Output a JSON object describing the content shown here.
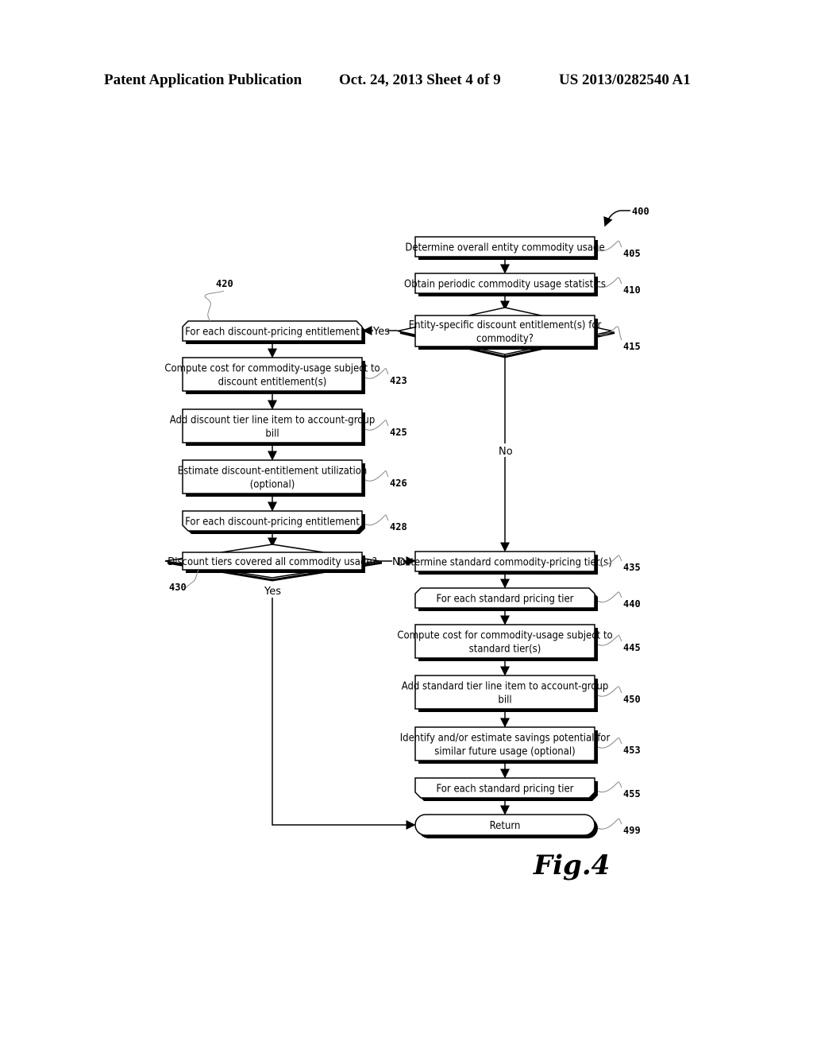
{
  "header": {
    "publication": "Patent Application Publication",
    "date_sheet": "Oct. 24, 2013   Sheet 4 of 9",
    "number": "US 2013/0282540 A1"
  },
  "diagram": {
    "ref": "400",
    "figure_label": "Fig.4",
    "nodes": {
      "n405": {
        "ref": "405",
        "lines": [
          "Determine overall entity commodity usage"
        ]
      },
      "n410": {
        "ref": "410",
        "lines": [
          "Obtain periodic commodity usage statistics"
        ]
      },
      "n415": {
        "ref": "415",
        "lines": [
          "Entity-specific discount entitlement(s) for",
          "commodity?"
        ]
      },
      "n420": {
        "ref": "420",
        "lines": [
          "For each discount-pricing entitlement"
        ]
      },
      "n423": {
        "ref": "423",
        "lines": [
          "Compute cost for commodity-usage subject to",
          "discount entitlement(s)"
        ]
      },
      "n425": {
        "ref": "425",
        "lines": [
          "Add discount tier line item to account-group",
          "bill"
        ]
      },
      "n426": {
        "ref": "426",
        "lines": [
          "Estimate discount-entitlement utilization",
          "(optional)"
        ]
      },
      "n428": {
        "ref": "428",
        "lines": [
          "For each discount-pricing entitlement"
        ]
      },
      "n430": {
        "ref": "430",
        "lines": [
          "Discount tiers covered all commodity usage?"
        ]
      },
      "n435": {
        "ref": "435",
        "lines": [
          "Determine standard commodity-pricing tier(s)"
        ]
      },
      "n440": {
        "ref": "440",
        "lines": [
          "For each standard pricing tier"
        ]
      },
      "n445": {
        "ref": "445",
        "lines": [
          "Compute cost for commodity-usage subject to",
          "standard tier(s)"
        ]
      },
      "n450": {
        "ref": "450",
        "lines": [
          "Add standard tier line item to account-group",
          "bill"
        ]
      },
      "n453": {
        "ref": "453",
        "lines": [
          "Identify and/or estimate savings potential for",
          "similar future usage (optional)"
        ]
      },
      "n455": {
        "ref": "455",
        "lines": [
          "For each standard pricing tier"
        ]
      },
      "n499": {
        "ref": "499",
        "lines": [
          "Return"
        ]
      }
    },
    "edge_labels": {
      "yes_415": "Yes",
      "no_415": "No",
      "no_430": "No",
      "yes_430": "Yes"
    }
  }
}
